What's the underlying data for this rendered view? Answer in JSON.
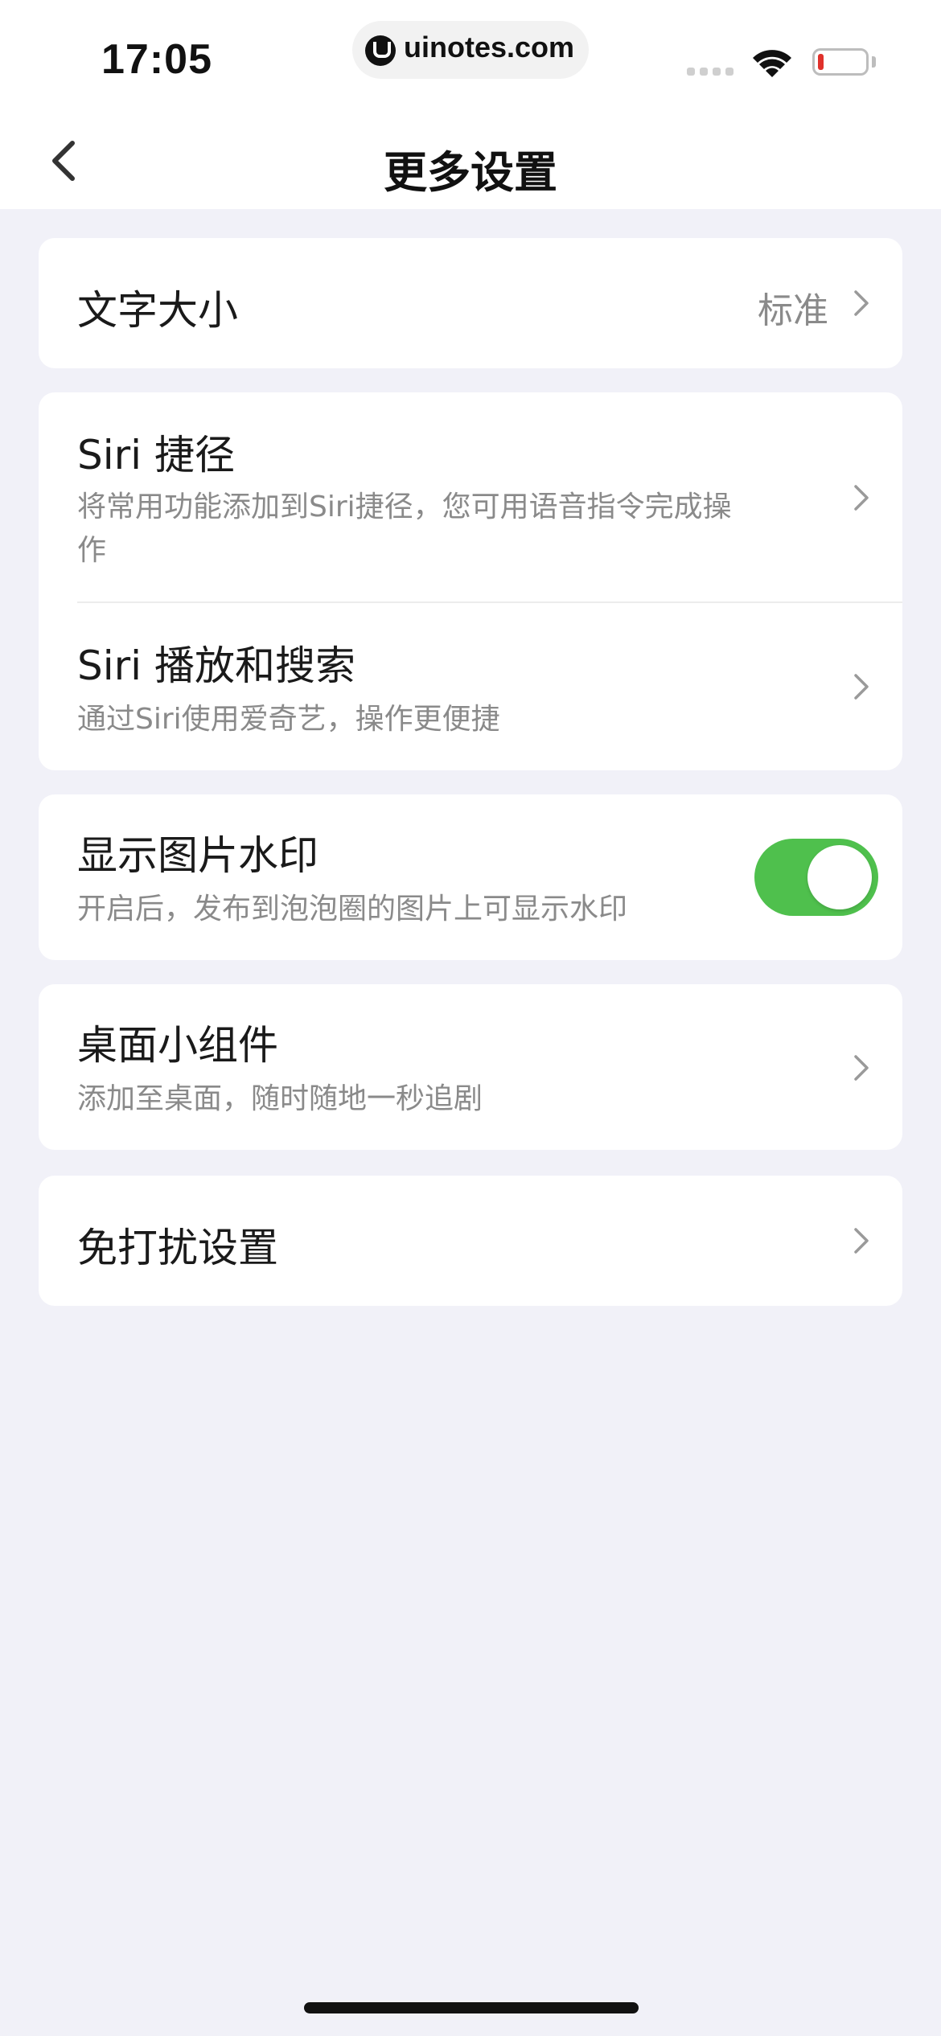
{
  "status_bar": {
    "time": "17:05",
    "url": "uinotes.com",
    "icons": [
      "signal-icon",
      "wifi-icon",
      "battery-icon"
    ],
    "battery_color": "#e0312b"
  },
  "nav": {
    "title": "更多设置",
    "back_icon": "chevron-left-icon"
  },
  "settings": {
    "font_size": {
      "title": "文字大小",
      "value": "标准"
    },
    "siri_shortcut": {
      "title": "Siri 捷径",
      "desc_line1": "将常用功能添加到Siri捷径，您可用语音指令完成操",
      "desc_line2": "作"
    },
    "siri_search": {
      "title": "Siri 播放和搜索",
      "desc": "通过Siri使用爱奇艺，操作更便捷"
    },
    "watermark": {
      "title": "显示图片水印",
      "desc": "开启后，发布到泡泡圈的图片上可显示水印",
      "toggle_on": true,
      "toggle_color": "#4fc04d"
    },
    "widget": {
      "title": "桌面小组件",
      "desc": "添加至桌面，随时随地一秒追剧"
    },
    "dnd": {
      "title": "免打扰设置"
    }
  }
}
